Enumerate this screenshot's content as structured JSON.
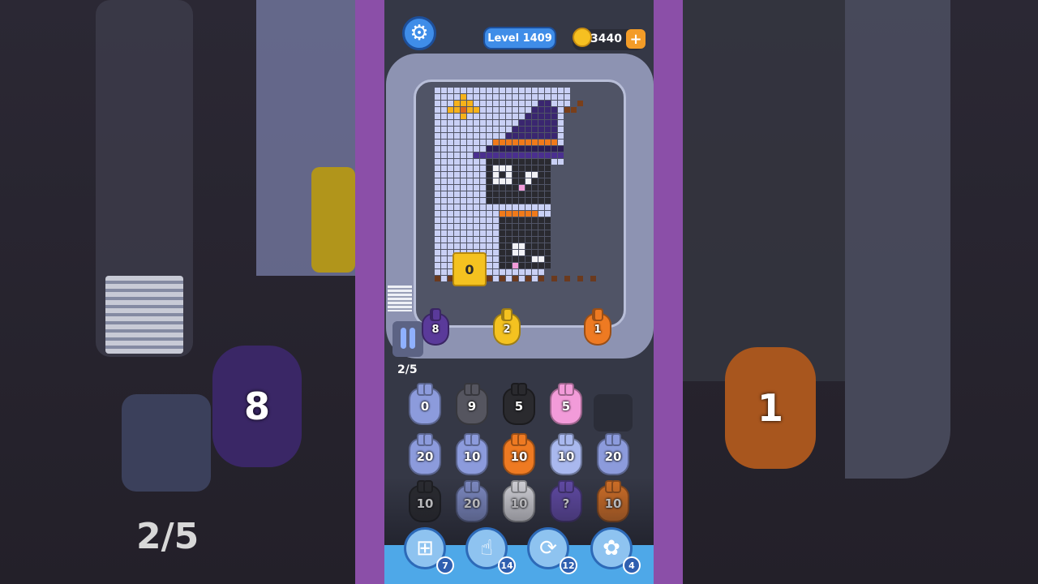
{
  "header": {
    "level_label": "Level 1409",
    "coins": "3440",
    "coin_plus": "+"
  },
  "board": {
    "block_counter": "0",
    "progress": "2/5"
  },
  "conveyor_bunnies": [
    {
      "count": "8",
      "color": "#5a3a9a"
    },
    {
      "count": "2",
      "color": "#f4c220"
    },
    {
      "count": "1",
      "color": "#ee7a22"
    }
  ],
  "grid_rows": [
    [
      {
        "count": "0",
        "color": "#8c9bdc"
      },
      {
        "count": "9",
        "color": "#55555f"
      },
      {
        "count": "5",
        "color": "#2a2a2e"
      },
      {
        "count": "5",
        "color": "#f29bd9"
      }
    ],
    [
      {
        "count": "20",
        "color": "#8c9bdc"
      },
      {
        "count": "10",
        "color": "#8c9bdc"
      },
      {
        "count": "10",
        "color": "#ee7a22"
      },
      {
        "count": "10",
        "color": "#a9b8ee"
      },
      {
        "count": "20",
        "color": "#8c9bdc"
      }
    ],
    [
      {
        "count": "10",
        "color": "#2a2a2e"
      },
      {
        "count": "20",
        "color": "#8c9bdc"
      },
      {
        "count": "10",
        "color": "#f0f0f4"
      },
      {
        "count": "?",
        "color": "#6a4fb8"
      },
      {
        "count": "10",
        "color": "#ee7a22"
      }
    ]
  ],
  "powerups": [
    {
      "name": "add-slot-icon",
      "glyph": "⊞",
      "count": "7"
    },
    {
      "name": "hand-tap-icon",
      "glyph": "☝",
      "count": "14"
    },
    {
      "name": "shuffle-icon",
      "glyph": "⟳",
      "count": "12"
    },
    {
      "name": "bunny-helper-icon",
      "glyph": "✿",
      "count": "4"
    }
  ],
  "background_zoom": {
    "left_bunny_count": "8",
    "left_progress": "2/5",
    "right_bunny_count": "1"
  }
}
